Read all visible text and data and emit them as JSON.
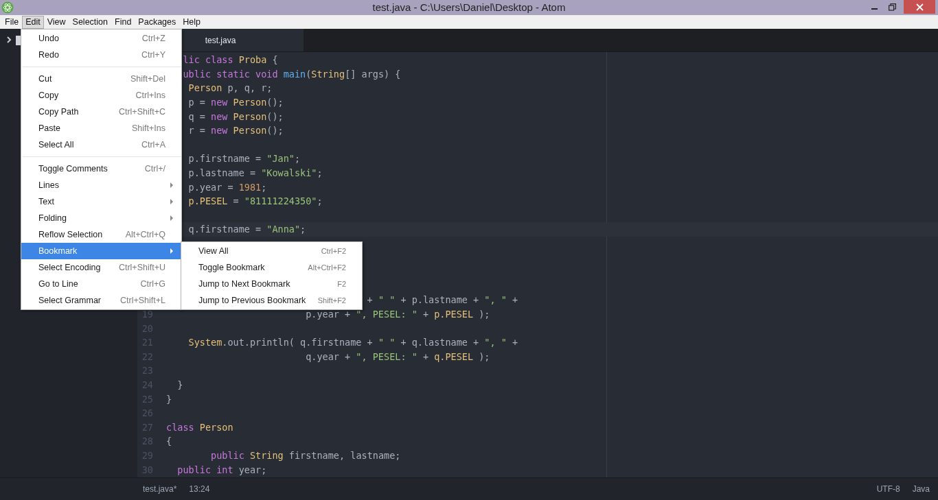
{
  "window": {
    "title": "test.java - C:\\Users\\Daniel\\Desktop - Atom"
  },
  "menu_bar": [
    {
      "label": "File",
      "selected": false
    },
    {
      "label": "Edit",
      "selected": true
    },
    {
      "label": "View",
      "selected": false
    },
    {
      "label": "Selection",
      "selected": false
    },
    {
      "label": "Find",
      "selected": false
    },
    {
      "label": "Packages",
      "selected": false
    },
    {
      "label": "Help",
      "selected": false
    }
  ],
  "tabs": [
    {
      "label": "test.java",
      "selected": true
    }
  ],
  "editor": {
    "lines": [
      {
        "current": false,
        "tokens": [
          {
            "kind": "keyword",
            "text": "   lic class "
          },
          {
            "kind": "type",
            "text": "Proba"
          },
          {
            "kind": "plain",
            "text": " {"
          }
        ]
      },
      {
        "current": false,
        "tokens": [
          {
            "kind": "keyword",
            "text": "   ublic static void "
          },
          {
            "kind": "function",
            "text": "main"
          },
          {
            "kind": "plain",
            "text": "("
          },
          {
            "kind": "type",
            "text": "String"
          },
          {
            "kind": "plain",
            "text": "[] args) {"
          }
        ]
      },
      {
        "current": false,
        "tokens": [
          {
            "kind": "type",
            "text": "    Person"
          },
          {
            "kind": "plain",
            "text": " p, q, r;"
          }
        ]
      },
      {
        "current": false,
        "tokens": [
          {
            "kind": "plain",
            "text": "    p = "
          },
          {
            "kind": "keyword",
            "text": "new "
          },
          {
            "kind": "type",
            "text": "Person"
          },
          {
            "kind": "plain",
            "text": "();"
          }
        ]
      },
      {
        "current": false,
        "tokens": [
          {
            "kind": "plain",
            "text": "    q = "
          },
          {
            "kind": "keyword",
            "text": "new "
          },
          {
            "kind": "type",
            "text": "Person"
          },
          {
            "kind": "plain",
            "text": "();"
          }
        ]
      },
      {
        "current": false,
        "tokens": [
          {
            "kind": "plain",
            "text": "    r = "
          },
          {
            "kind": "keyword",
            "text": "new "
          },
          {
            "kind": "type",
            "text": "Person"
          },
          {
            "kind": "plain",
            "text": "();"
          }
        ]
      },
      {
        "current": false
      },
      {
        "current": false,
        "tokens": [
          {
            "kind": "plain",
            "text": "    p.firstname = "
          },
          {
            "kind": "string",
            "text": "\"Jan\""
          },
          {
            "kind": "plain",
            "text": ";"
          }
        ]
      },
      {
        "current": false,
        "tokens": [
          {
            "kind": "plain",
            "text": "    p.lastname = "
          },
          {
            "kind": "string",
            "text": "\"Kowalski\""
          },
          {
            "kind": "plain",
            "text": ";"
          }
        ]
      },
      {
        "current": false,
        "tokens": [
          {
            "kind": "plain",
            "text": "    p.year = "
          },
          {
            "kind": "number",
            "text": "1981"
          },
          {
            "kind": "plain",
            "text": ";"
          }
        ]
      },
      {
        "current": false,
        "tokens": [
          {
            "kind": "constant",
            "text": "    p.PESEL"
          },
          {
            "kind": "plain",
            "text": " = "
          },
          {
            "kind": "string",
            "text": "\"81111224350\""
          },
          {
            "kind": "plain",
            "text": ";"
          }
        ]
      },
      {
        "current": false
      },
      {
        "current": true,
        "tokens": [
          {
            "kind": "plain",
            "text": "    q.firstname = "
          },
          {
            "kind": "string",
            "text": "\"Anna\""
          },
          {
            "kind": "plain",
            "text": ";"
          }
        ]
      },
      {
        "current": false
      },
      {
        "current": false
      },
      {
        "current": false
      },
      {
        "current": false
      },
      {
        "current": false,
        "tokens": [
          {
            "kind": "plain",
            "text": "                                    + "
          },
          {
            "kind": "string",
            "text": "\" \""
          },
          {
            "kind": "plain",
            "text": " + p.lastname + "
          },
          {
            "kind": "string",
            "text": "\", \""
          },
          {
            "kind": "plain",
            "text": " +"
          }
        ]
      },
      {
        "number": "19",
        "current": false,
        "tokens": [
          {
            "kind": "plain",
            "text": "                         p.year + "
          },
          {
            "kind": "string",
            "text": "\", PESEL: \""
          },
          {
            "kind": "plain",
            "text": " + "
          },
          {
            "kind": "constant",
            "text": "p.PESEL"
          },
          {
            "kind": "plain",
            "text": " );"
          }
        ]
      },
      {
        "number": "20",
        "current": false
      },
      {
        "number": "21",
        "current": false,
        "tokens": [
          {
            "kind": "type",
            "text": "    System"
          },
          {
            "kind": "plain",
            "text": ".out.println( q.firstname + "
          },
          {
            "kind": "string",
            "text": "\" \""
          },
          {
            "kind": "plain",
            "text": " + q.lastname + "
          },
          {
            "kind": "string",
            "text": "\", \""
          },
          {
            "kind": "plain",
            "text": " +"
          }
        ]
      },
      {
        "number": "22",
        "current": false,
        "tokens": [
          {
            "kind": "plain",
            "text": "                         q.year + "
          },
          {
            "kind": "string",
            "text": "\", PESEL: \""
          },
          {
            "kind": "plain",
            "text": " + "
          },
          {
            "kind": "constant",
            "text": "q.PESEL"
          },
          {
            "kind": "plain",
            "text": " );"
          }
        ]
      },
      {
        "number": "23",
        "current": false
      },
      {
        "number": "24",
        "current": false,
        "tokens": [
          {
            "kind": "plain",
            "text": "  }"
          }
        ]
      },
      {
        "number": "25",
        "current": false,
        "tokens": [
          {
            "kind": "plain",
            "text": "}"
          }
        ]
      },
      {
        "number": "26",
        "current": false
      },
      {
        "number": "27",
        "current": false,
        "tokens": [
          {
            "kind": "keyword",
            "text": "class "
          },
          {
            "kind": "type",
            "text": "Person"
          }
        ]
      },
      {
        "number": "28",
        "current": false,
        "tokens": [
          {
            "kind": "plain",
            "text": "{"
          }
        ]
      },
      {
        "number": "29",
        "current": false,
        "tokens": [
          {
            "kind": "keyword",
            "text": "        public "
          },
          {
            "kind": "type",
            "text": "String"
          },
          {
            "kind": "plain",
            "text": " firstname, lastname;"
          }
        ]
      },
      {
        "number": "30",
        "current": false,
        "tokens": [
          {
            "kind": "keyword",
            "text": "  public int"
          },
          {
            "kind": "plain",
            "text": " year;"
          }
        ]
      }
    ]
  },
  "edit_menu": {
    "items": [
      {
        "kind": "item",
        "label": "Undo",
        "shortcut": "Ctrl+Z",
        "selected": false
      },
      {
        "kind": "item",
        "label": "Redo",
        "shortcut": "Ctrl+Y",
        "selected": false
      },
      {
        "kind": "separator"
      },
      {
        "kind": "item",
        "label": "Cut",
        "shortcut": "Shift+Del",
        "selected": false
      },
      {
        "kind": "item",
        "label": "Copy",
        "shortcut": "Ctrl+Ins",
        "selected": false
      },
      {
        "kind": "item",
        "label": "Copy Path",
        "shortcut": "Ctrl+Shift+C",
        "selected": false
      },
      {
        "kind": "item",
        "label": "Paste",
        "shortcut": "Shift+Ins",
        "selected": false
      },
      {
        "kind": "item",
        "label": "Select All",
        "shortcut": "Ctrl+A",
        "selected": false
      },
      {
        "kind": "separator"
      },
      {
        "kind": "item",
        "label": "Toggle Comments",
        "shortcut": "Ctrl+/",
        "selected": false
      },
      {
        "kind": "submenu",
        "label": "Lines",
        "selected": false
      },
      {
        "kind": "submenu",
        "label": "Text",
        "selected": false
      },
      {
        "kind": "submenu",
        "label": "Folding",
        "selected": false
      },
      {
        "kind": "item",
        "label": "Reflow Selection",
        "shortcut": "Alt+Ctrl+Q",
        "selected": false
      },
      {
        "kind": "submenu",
        "label": "Bookmark",
        "selected": true
      },
      {
        "kind": "item",
        "label": "Select Encoding",
        "shortcut": "Ctrl+Shift+U",
        "selected": false
      },
      {
        "kind": "item",
        "label": "Go to Line",
        "shortcut": "Ctrl+G",
        "selected": false
      },
      {
        "kind": "item",
        "label": "Select Grammar",
        "shortcut": "Ctrl+Shift+L",
        "selected": false
      }
    ]
  },
  "bookmark_submenu": {
    "items": [
      {
        "kind": "item",
        "label": "View All",
        "shortcut": "Ctrl+F2",
        "selected": false
      },
      {
        "kind": "item",
        "label": "Toggle Bookmark",
        "shortcut": "Alt+Ctrl+F2",
        "selected": false
      },
      {
        "kind": "item",
        "label": "Jump to Next Bookmark",
        "shortcut": "F2",
        "selected": false
      },
      {
        "kind": "item",
        "label": "Jump to Previous Bookmark",
        "shortcut": "Shift+F2",
        "selected": false
      }
    ]
  },
  "status_bar": {
    "file": "test.java*",
    "cursor": "13:24",
    "encoding": "UTF-8",
    "grammar": "Java"
  }
}
